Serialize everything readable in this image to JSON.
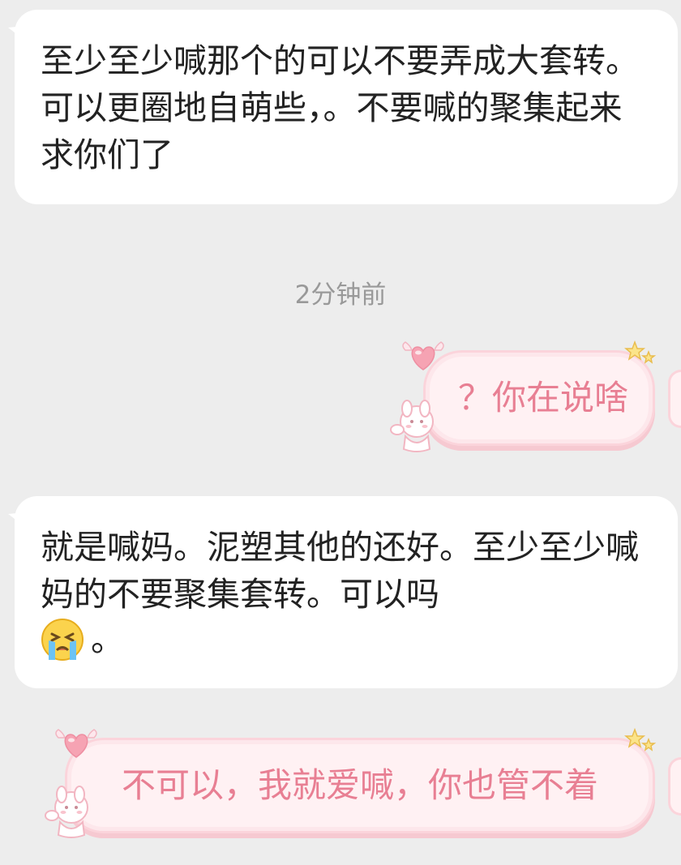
{
  "messages": {
    "incoming_1": "至少至少喊那个的可以不要弄成大套转。 可以更圈地自萌些，。不要喊的聚集起来求你们了",
    "timestamp": "2分钟前",
    "outgoing_1": "？你在说啥",
    "incoming_2": "就是喊妈。泥塑其他的还好。至少至少喊妈的不要聚集套转。可以吗",
    "incoming_2_suffix": "。",
    "outgoing_2": "不可以，我就爱喊，你也管不着"
  },
  "emoji": {
    "incoming_2": "crying-face-emoji"
  },
  "colors": {
    "background": "#ededed",
    "incoming_bubble": "#ffffff",
    "outgoing_bubble": "#fff1f3",
    "outgoing_text": "#e87f93",
    "timestamp": "#999999"
  }
}
